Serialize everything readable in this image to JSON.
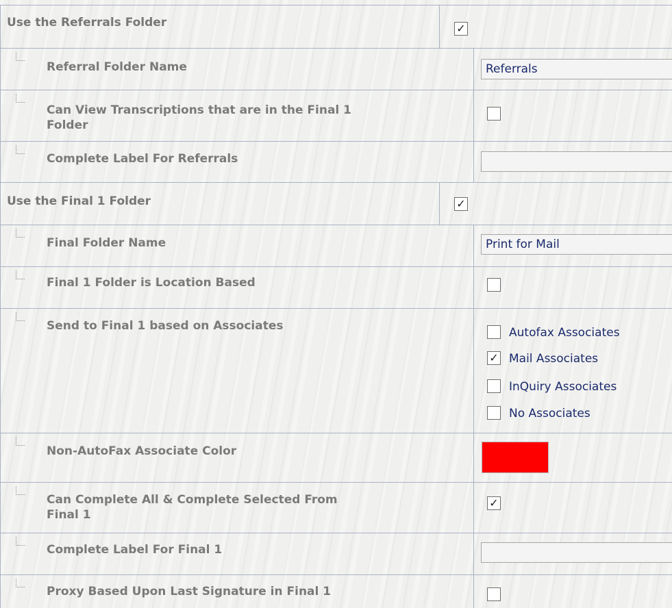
{
  "settings": {
    "use_referrals": {
      "label": "Use the Referrals Folder",
      "checked": true
    },
    "referral_folder_name": {
      "label": "Referral Folder Name",
      "value": "Referrals"
    },
    "can_view_transcriptions": {
      "label_line1": "Can View Transcriptions that are in the Final 1",
      "label_line2": "Folder",
      "checked": false
    },
    "complete_label_referrals": {
      "label": "Complete Label For Referrals",
      "value": ""
    },
    "use_final1": {
      "label": "Use the Final 1 Folder",
      "checked": true
    },
    "final_folder_name": {
      "label": "Final Folder Name",
      "value": "Print for Mail"
    },
    "final1_location_based": {
      "label": "Final 1 Folder is Location Based",
      "checked": false
    },
    "send_to_final1": {
      "label": "Send to Final 1 based on Associates",
      "options": [
        {
          "label": "Autofax Associates",
          "checked": false
        },
        {
          "label": "Mail Associates",
          "checked": true
        },
        {
          "label": "InQuiry Associates",
          "checked": false
        },
        {
          "label": "No Associates",
          "checked": false
        }
      ]
    },
    "non_autofax_color": {
      "label": "Non-AutoFax Associate Color",
      "color": "#ff0000"
    },
    "can_complete_all": {
      "label_line1": "Can Complete All & Complete Selected From",
      "label_line2": "Final 1",
      "checked": true
    },
    "complete_label_final1": {
      "label": "Complete Label For Final 1",
      "value": ""
    },
    "proxy_last_signature": {
      "label": "Proxy Based Upon Last Signature in Final 1",
      "checked": false
    }
  },
  "check_glyph": "✓"
}
